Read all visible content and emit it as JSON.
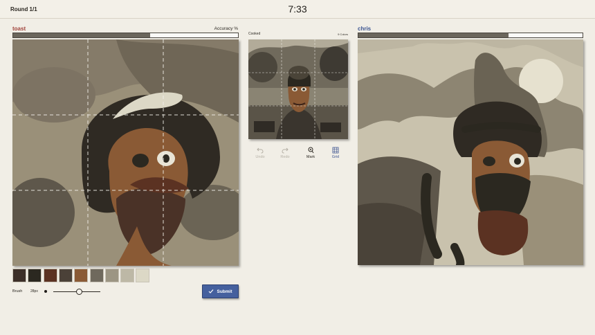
{
  "header": {
    "round": "Round 1/1",
    "timer": "7:33"
  },
  "player_left": {
    "name": "toast",
    "name_color": "#a0423a",
    "accuracy_label": "Accuracy %",
    "accuracy_fraction": 0.61
  },
  "player_right": {
    "name": "chris",
    "name_color": "#3c5591",
    "accuracy_fraction": 0.67
  },
  "reference": {
    "title": "Cooked",
    "colors": "9 Colors"
  },
  "tools": [
    {
      "label": "Undo",
      "icon": "undo-icon",
      "enabled": false
    },
    {
      "label": "Redo",
      "icon": "redo-icon",
      "enabled": false
    },
    {
      "label": "Mark",
      "icon": "mark-icon",
      "enabled": true
    },
    {
      "label": "Grid",
      "icon": "grid-icon",
      "enabled": true
    }
  ],
  "palette": [
    "#3c2f28",
    "#2b2820",
    "#5b3222",
    "#4b4138",
    "#8a5a35",
    "#6f695d",
    "#9c9583",
    "#bdb8a6",
    "#dcd8c6"
  ],
  "brush": {
    "label": "Brush",
    "size": "28px",
    "slider_fraction": 0.55
  },
  "submit": {
    "label": "Submit"
  }
}
